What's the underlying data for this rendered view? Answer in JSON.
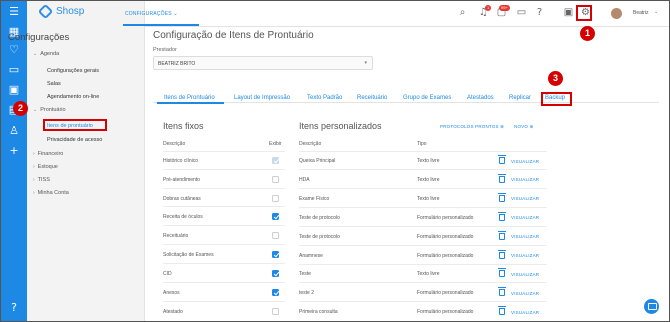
{
  "app": {
    "logo": "Shosp"
  },
  "breadcrumb": {
    "label": "CONFIGURAÇÕES",
    "chevron": "⌄"
  },
  "topbar": {
    "icons": [
      "search-icon",
      "bell-icon",
      "chat-icon",
      "monitor-icon",
      "help-icon",
      "print-icon",
      "gear-icon"
    ],
    "badges": {
      "bell": "1",
      "chat": "99+"
    },
    "user_name": "Beatriz"
  },
  "rail": {
    "icons": [
      "menu-icon",
      "calendar-icon",
      "heart-icon",
      "money-icon",
      "folder-icon",
      "chart-icon",
      "user-edit-icon",
      "plus-icon",
      "help-icon"
    ]
  },
  "settings": {
    "title": "Configurações",
    "groups": [
      {
        "label": "Agenda",
        "items": [
          "Configurações gerais",
          "Salas",
          "Agendamento on-line"
        ]
      },
      {
        "label": "Prontuário",
        "items": [
          "Itens de prontuário",
          "Privacidade de acesso"
        ]
      },
      {
        "label": "Financeiro"
      },
      {
        "label": "Estoque"
      },
      {
        "label": "TISS"
      },
      {
        "label": "Minha Conta"
      }
    ]
  },
  "main": {
    "title": "Configuração de Itens de Prontuário",
    "prestador_label": "Prestador",
    "prestador_value": "BEATRIZ BRITO",
    "tabs": [
      "Itens de Prontuário",
      "Layout de Impressão",
      "Texto Padrão",
      "Receituário",
      "Grupo de Exames",
      "Atestados",
      "Replicar",
      "Backup"
    ],
    "fixed": {
      "title": "Itens fixos",
      "col_desc": "Descrição",
      "col_show": "Exibir",
      "rows": [
        {
          "label": "Histórico clínico",
          "checked": "dim"
        },
        {
          "label": "Pré-atendimento",
          "checked": "off"
        },
        {
          "label": "Dobras cutâneas",
          "checked": "off"
        },
        {
          "label": "Receita de óculos",
          "checked": "on"
        },
        {
          "label": "Receituário",
          "checked": "off"
        },
        {
          "label": "Solicitação de Exames",
          "checked": "on"
        },
        {
          "label": "CID",
          "checked": "on"
        },
        {
          "label": "Anexos",
          "checked": "on"
        },
        {
          "label": "Atestado",
          "checked": "off"
        }
      ]
    },
    "custom": {
      "title": "Itens personalizados",
      "link_protocols": "PROTOCOLOS PRONTOS",
      "link_new": "NOVO",
      "col_desc": "Descrição",
      "col_type": "Tipo",
      "action_label": "VISUALIZAR",
      "rows": [
        {
          "desc": "Queixa Principal",
          "type": "Texto livre"
        },
        {
          "desc": "HDA",
          "type": "Texto livre"
        },
        {
          "desc": "Exame Físico",
          "type": "Texto livre"
        },
        {
          "desc": "Teste de protocolo",
          "type": "Formulário personalizado"
        },
        {
          "desc": "Teste de protocolo",
          "type": "Formulário personalizado"
        },
        {
          "desc": "Anamnese",
          "type": "Formulário personalizado"
        },
        {
          "desc": "Teste",
          "type": "Texto livre"
        },
        {
          "desc": "teste 2",
          "type": "Formulário personalizado"
        },
        {
          "desc": "Primeira consulta",
          "type": "Formulário personalizado"
        }
      ]
    }
  },
  "annotations": {
    "markers": [
      "1",
      "2",
      "3"
    ]
  },
  "colors": {
    "accent": "#1e88e5",
    "annotation": "#d50000",
    "pane": "#f3f3f3"
  }
}
